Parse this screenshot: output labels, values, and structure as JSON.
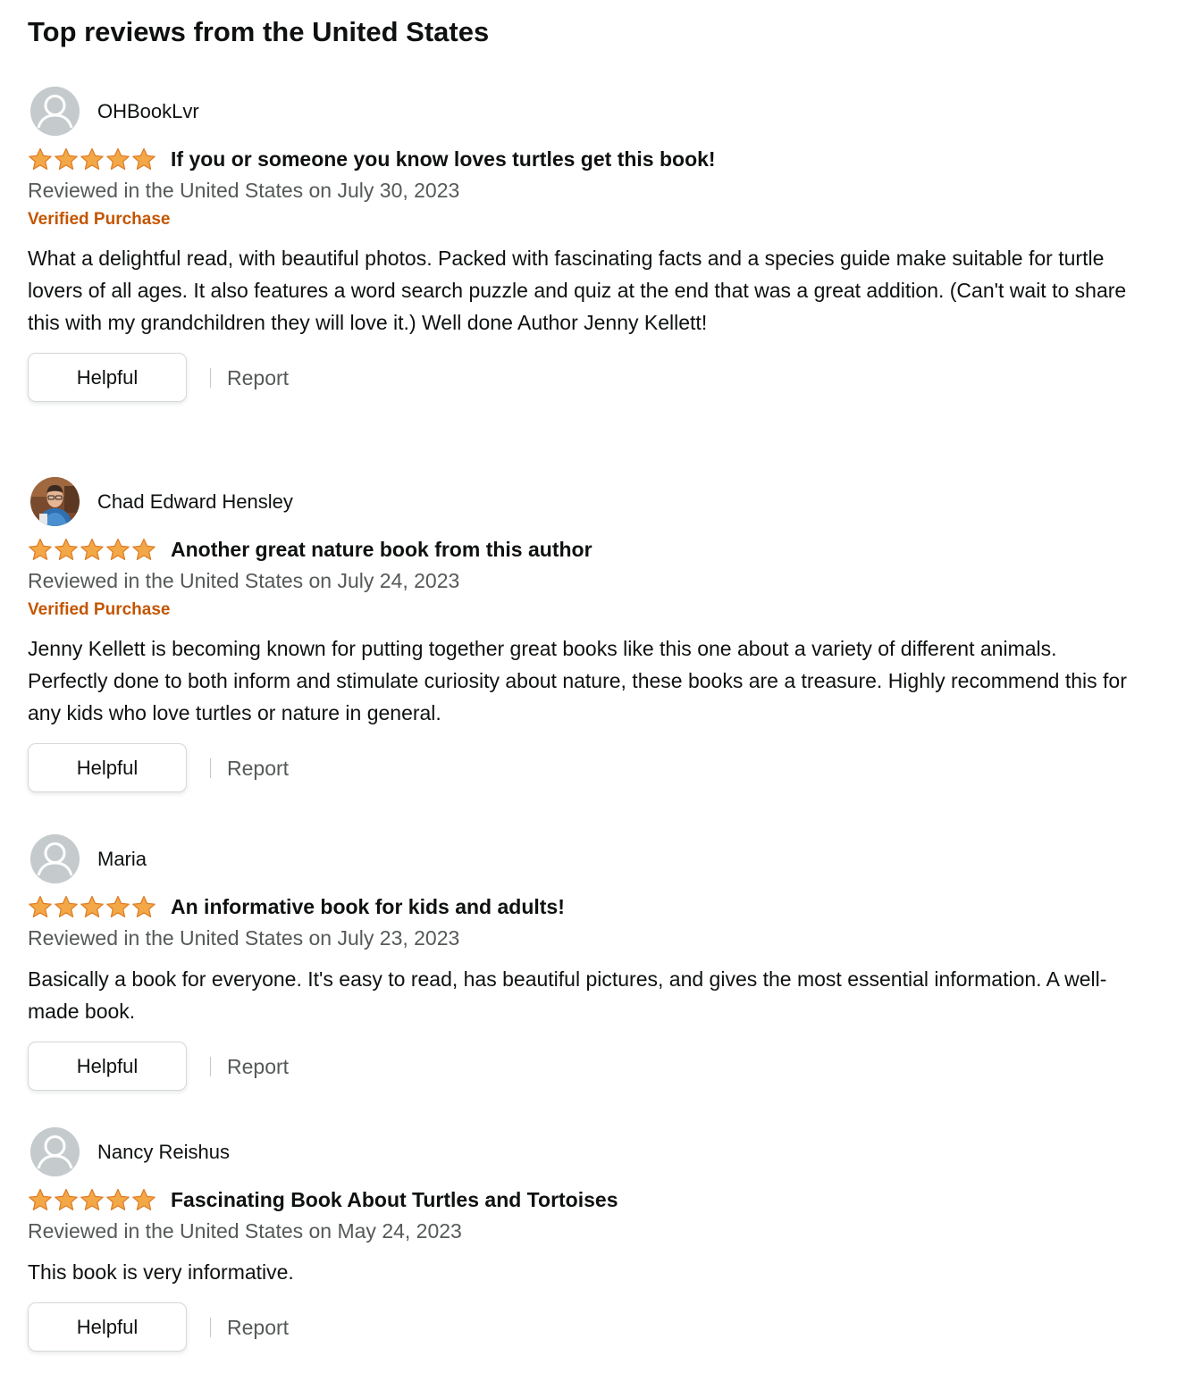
{
  "section": {
    "title": "Top reviews from the United States"
  },
  "colors": {
    "star": "#f3a847",
    "verified": "#c45500",
    "meta": "#565959"
  },
  "reviews": [
    {
      "author": "OHBookLvr",
      "avatar": "default-avatar-icon",
      "rating": 5,
      "max_rating": 5,
      "title": "If you or someone you know loves turtles get this book!",
      "date": "Reviewed in the United States on July 30, 2023",
      "verified": "Verified Purchase",
      "body": "What a delightful read, with beautiful photos. Packed with fascinating facts and a species guide make suitable for turtle lovers of all ages. It also features a word search puzzle and quiz at the end that was a great addition. (Can't wait to share this with my grandchildren they will love it.) Well done Author Jenny Kellett!",
      "helpful_label": "Helpful",
      "report_label": "Report"
    },
    {
      "author": "Chad Edward Hensley",
      "avatar": "user-photo-avatar",
      "rating": 5,
      "max_rating": 5,
      "title": "Another great nature book from this author",
      "date": "Reviewed in the United States on July 24, 2023",
      "verified": "Verified Purchase",
      "body": "Jenny Kellett is becoming known for putting together great books like this one about a variety of different animals. Perfectly done to both inform and stimulate curiosity about nature, these books are a treasure. Highly recommend this for any kids who love turtles or nature in general.",
      "helpful_label": "Helpful",
      "report_label": "Report"
    },
    {
      "author": "Maria",
      "avatar": "default-avatar-icon",
      "rating": 5,
      "max_rating": 5,
      "title": "An informative book for kids and adults!",
      "date": "Reviewed in the United States on July 23, 2023",
      "body": "Basically a book for everyone. It's easy to read, has beautiful pictures, and gives the most essential information. A well-made book.",
      "helpful_label": "Helpful",
      "report_label": "Report"
    },
    {
      "author": "Nancy Reishus",
      "avatar": "default-avatar-icon",
      "rating": 5,
      "max_rating": 5,
      "title": "Fascinating Book About Turtles and Tortoises",
      "date": "Reviewed in the United States on May 24, 2023",
      "body": "This book is very informative.",
      "helpful_label": "Helpful",
      "report_label": "Report"
    }
  ]
}
